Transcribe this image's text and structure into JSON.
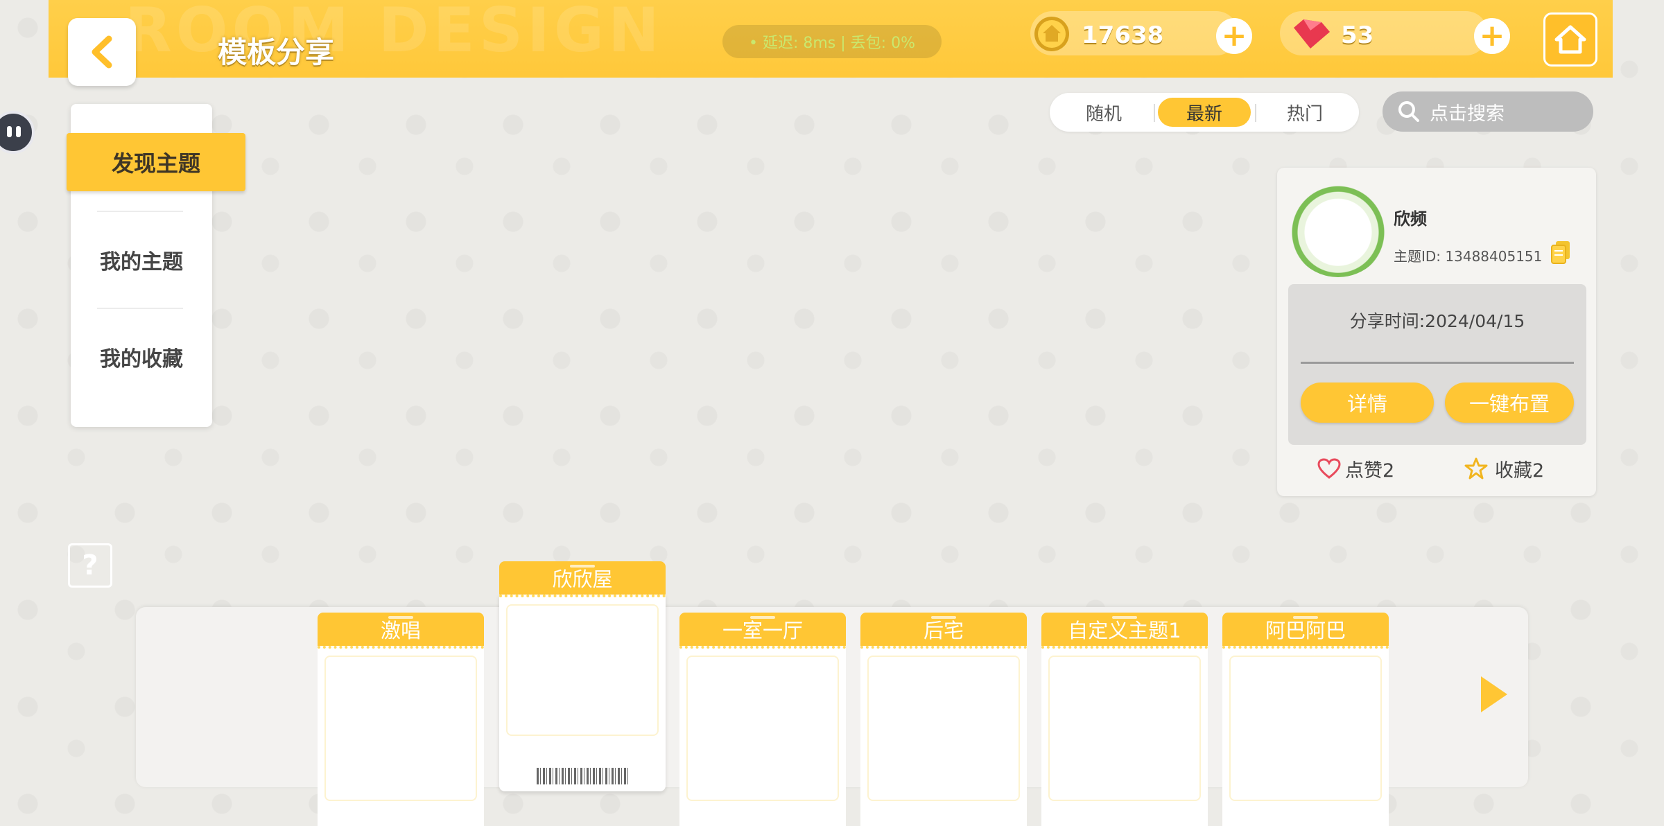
{
  "header": {
    "title": "模板分享",
    "network_status": "• 延迟: 8ms | 丢包: 0%",
    "coins": "17638",
    "gems": "53",
    "plus_symbol": "+"
  },
  "left_menu": {
    "items": [
      {
        "label": "发现主题",
        "active": true
      },
      {
        "label": "我的主题",
        "active": false
      },
      {
        "label": "我的收藏",
        "active": false
      }
    ]
  },
  "sort_tabs": [
    {
      "label": "随机",
      "active": false
    },
    {
      "label": "最新",
      "active": true
    },
    {
      "label": "热门",
      "active": false
    }
  ],
  "search": {
    "placeholder": "点击搜索"
  },
  "info_card": {
    "username": "欣频",
    "theme_id": "主题ID: 13488405151",
    "share_time": "分享时间:2024/04/15",
    "details_button": "详情",
    "apply_button": "一键布置",
    "likes": "点赞2",
    "favorites": "收藏2"
  },
  "help": {
    "symbol": "?"
  },
  "themes": [
    {
      "label": "激唱",
      "selected": false
    },
    {
      "label": "欣欣屋",
      "selected": true
    },
    {
      "label": "一室一厅",
      "selected": false
    },
    {
      "label": "后宅",
      "selected": false
    },
    {
      "label": "自定义主题1",
      "selected": false
    },
    {
      "label": "阿巴阿巴",
      "selected": false
    }
  ],
  "colors": {
    "accent": "#ffc634",
    "bar": "#ffcf4a",
    "background": "#ecebe7"
  },
  "icons": [
    "back-arrow-icon",
    "coin-icon",
    "gem-icon",
    "plus-icon",
    "home-icon",
    "search-icon",
    "copy-icon",
    "heart-icon",
    "star-icon",
    "question-icon",
    "next-arrow-icon"
  ]
}
